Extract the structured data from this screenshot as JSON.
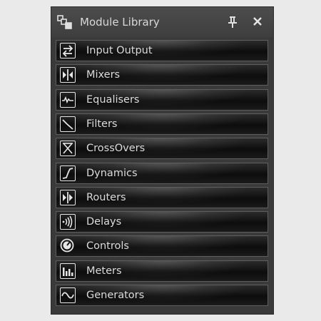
{
  "panel": {
    "title": "Module Library",
    "title_icon": "modules-icon",
    "pin_icon": "pin-icon",
    "close_icon": "close-icon"
  },
  "items": [
    {
      "label": "Input Output",
      "icon": "input-output-icon"
    },
    {
      "label": "Mixers",
      "icon": "mixers-icon"
    },
    {
      "label": "Equalisers",
      "icon": "equalisers-icon"
    },
    {
      "label": "Filters",
      "icon": "filters-icon"
    },
    {
      "label": "CrossOvers",
      "icon": "crossovers-icon"
    },
    {
      "label": "Dynamics",
      "icon": "dynamics-icon"
    },
    {
      "label": "Routers",
      "icon": "routers-icon"
    },
    {
      "label": "Delays",
      "icon": "delays-icon"
    },
    {
      "label": "Controls",
      "icon": "controls-icon"
    },
    {
      "label": "Meters",
      "icon": "meters-icon"
    },
    {
      "label": "Generators",
      "icon": "generators-icon"
    }
  ],
  "colors": {
    "panel_bg": "#3a3a3a",
    "item_text": "#dcdcdc",
    "icon_stroke": "#e6e6e6"
  }
}
